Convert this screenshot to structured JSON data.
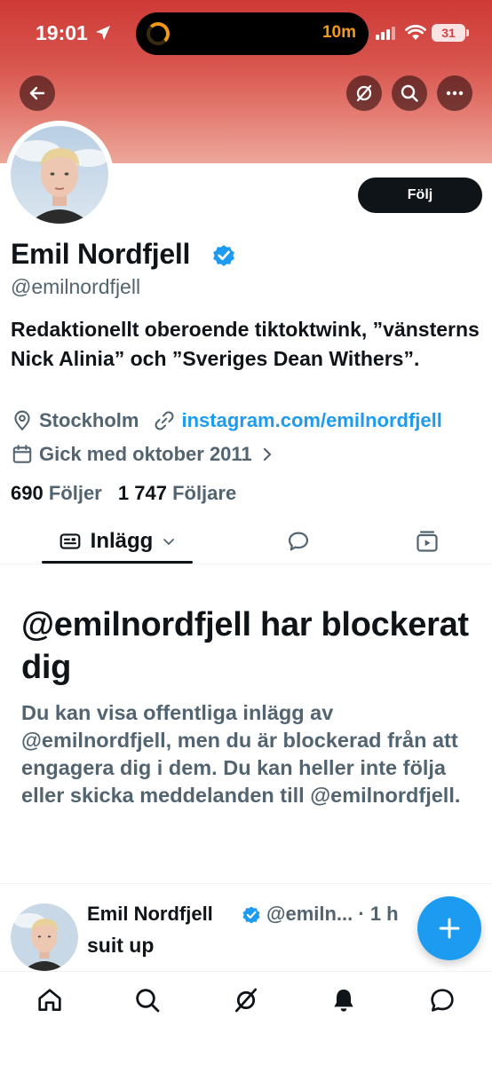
{
  "status_bar": {
    "time": "19:01",
    "timer": "10m",
    "battery": "31"
  },
  "header": {
    "back_icon": "arrow-left-icon",
    "grok_icon": "grok-icon",
    "search_icon": "search-icon",
    "more_icon": "more-icon"
  },
  "profile": {
    "name": "Emil Nordfjell",
    "handle": "@emilnordfjell",
    "follow_label": "Följ",
    "bio": "Redaktionellt oberoende tiktoktwink, ”vänsterns Nick Alinia” och ”Sveriges Dean Withers”.",
    "location": "Stockholm",
    "website": "instagram.com/emilnordfjell",
    "joined": "Gick med oktober 2011",
    "following_count": "690",
    "following_label": "Följer",
    "followers_count": "1 747",
    "followers_label": "Följare"
  },
  "tabs": {
    "posts_label": "Inlägg"
  },
  "blocked": {
    "title": "@emilnordfjell har blockerat dig",
    "body": "Du kan visa offentliga inlägg av @emilnordfjell, men du är blockerad från att engagera dig i dem. Du kan heller inte följa eller skicka meddelanden till @emilnordfjell."
  },
  "tweet": {
    "name": "Emil Nordfjell",
    "handle": "@emiln...",
    "time": "· 1 h",
    "text": "suit up"
  },
  "colors": {
    "accent": "#1d9bf0",
    "text": "#0f1419",
    "muted": "#536471",
    "banner": "#d8554e"
  }
}
